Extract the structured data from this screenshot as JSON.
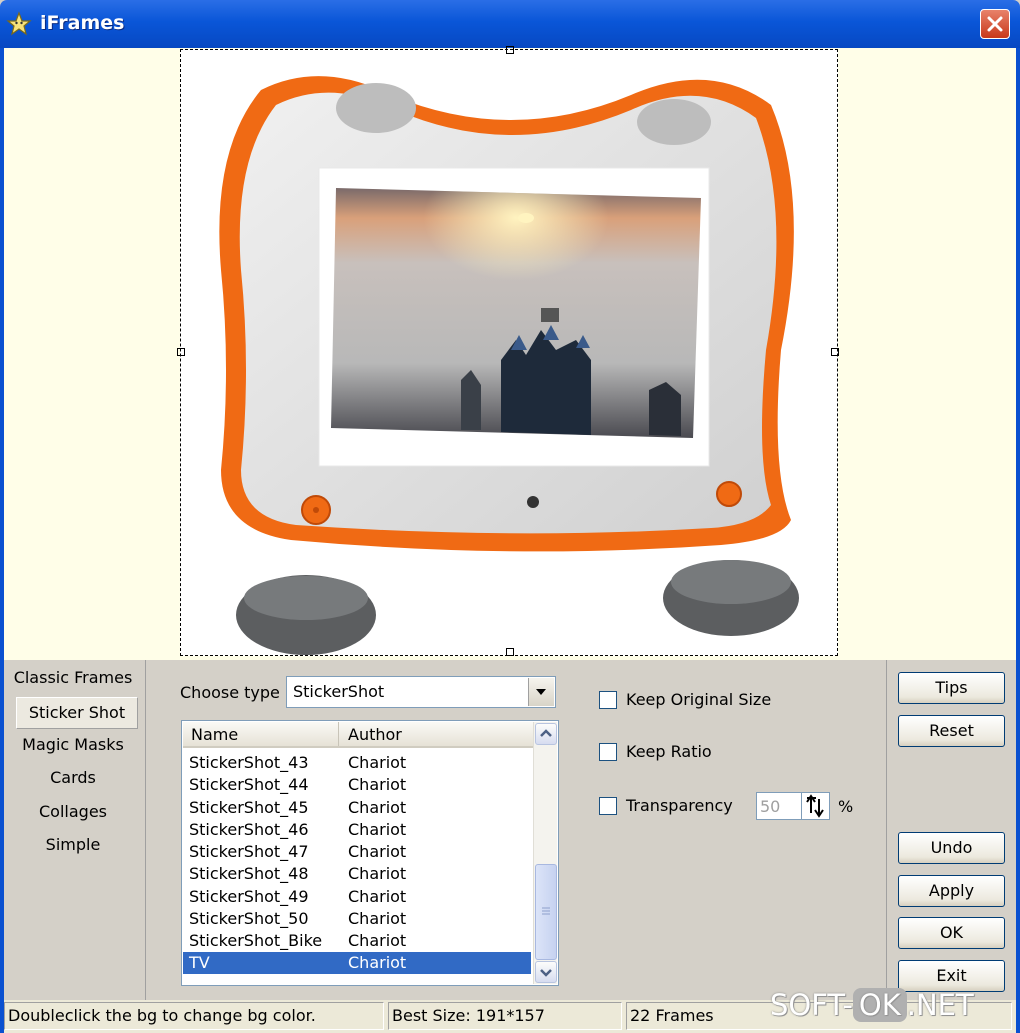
{
  "window": {
    "title": "iFrames"
  },
  "categories": [
    "Classic Frames",
    "Sticker Shot",
    "Magic Masks",
    "Cards",
    "Collages",
    "Simple"
  ],
  "choose_type": {
    "label": "Choose type",
    "value": "StickerShot"
  },
  "list": {
    "headers": {
      "name": "Name",
      "author": "Author"
    },
    "rows": [
      {
        "name": "StickerShot_43",
        "author": "Chariot"
      },
      {
        "name": "StickerShot_44",
        "author": "Chariot"
      },
      {
        "name": "StickerShot_45",
        "author": "Chariot"
      },
      {
        "name": "StickerShot_46",
        "author": "Chariot"
      },
      {
        "name": "StickerShot_47",
        "author": "Chariot"
      },
      {
        "name": "StickerShot_48",
        "author": "Chariot"
      },
      {
        "name": "StickerShot_49",
        "author": "Chariot"
      },
      {
        "name": "StickerShot_50",
        "author": "Chariot"
      },
      {
        "name": "StickerShot_Bike",
        "author": "Chariot"
      },
      {
        "name": "TV",
        "author": "Chariot"
      }
    ],
    "selected": "TV"
  },
  "options": {
    "keep_original_size": "Keep Original Size",
    "keep_ratio": "Keep Ratio",
    "transparency": "Transparency",
    "transparency_value": "50",
    "percent": "%"
  },
  "buttons": {
    "tips": "Tips",
    "reset": "Reset",
    "undo": "Undo",
    "apply": "Apply",
    "ok": "OK",
    "exit": "Exit"
  },
  "status": {
    "hint": "Doubleclick the bg to change bg color.",
    "best_size": "Best Size: 191*157",
    "frames": "22 Frames"
  },
  "watermark": {
    "left": "SOFT-",
    "mid": "OK",
    "right": ".NET"
  },
  "colors": {
    "titlebar": "#0a56d8",
    "accent_orange": "#f06a14",
    "selection": "#316ac5"
  }
}
